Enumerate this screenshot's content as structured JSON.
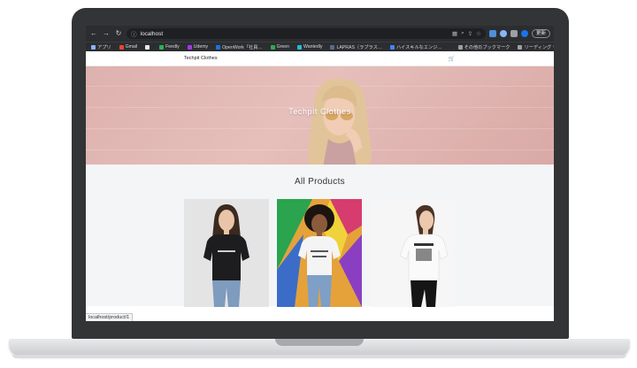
{
  "browser": {
    "url": "localhost",
    "profile_label": "更新",
    "bookmarks": [
      {
        "label": "アプリ",
        "color": "#8ab4f8"
      },
      {
        "label": "Gmail",
        "color": "#ea4335"
      },
      {
        "label": "",
        "color": "#e8eaed"
      },
      {
        "label": "Feedly",
        "color": "#2bb24c"
      },
      {
        "label": "Udemy",
        "color": "#a435f0"
      },
      {
        "label": "OpenWork「社員…",
        "color": "#1a73e8"
      },
      {
        "label": "Green",
        "color": "#34a853"
      },
      {
        "label": "Wantedly",
        "color": "#21bddb"
      },
      {
        "label": "LAPRAS（ラプラス…",
        "color": "#5a6a8a"
      },
      {
        "label": "ハイスキルなエンジ…",
        "color": "#4285f4"
      }
    ],
    "bookmarks_right": [
      {
        "label": "その他のブックマーク",
        "color": "#9aa0a6"
      },
      {
        "label": "リーディング リスト",
        "color": "#9aa0a6"
      }
    ]
  },
  "site": {
    "brand": "Techpit Clothes",
    "hero_title": "Techpit Clothes",
    "section_title": "All Products"
  },
  "status_url": "localhost/product/1"
}
